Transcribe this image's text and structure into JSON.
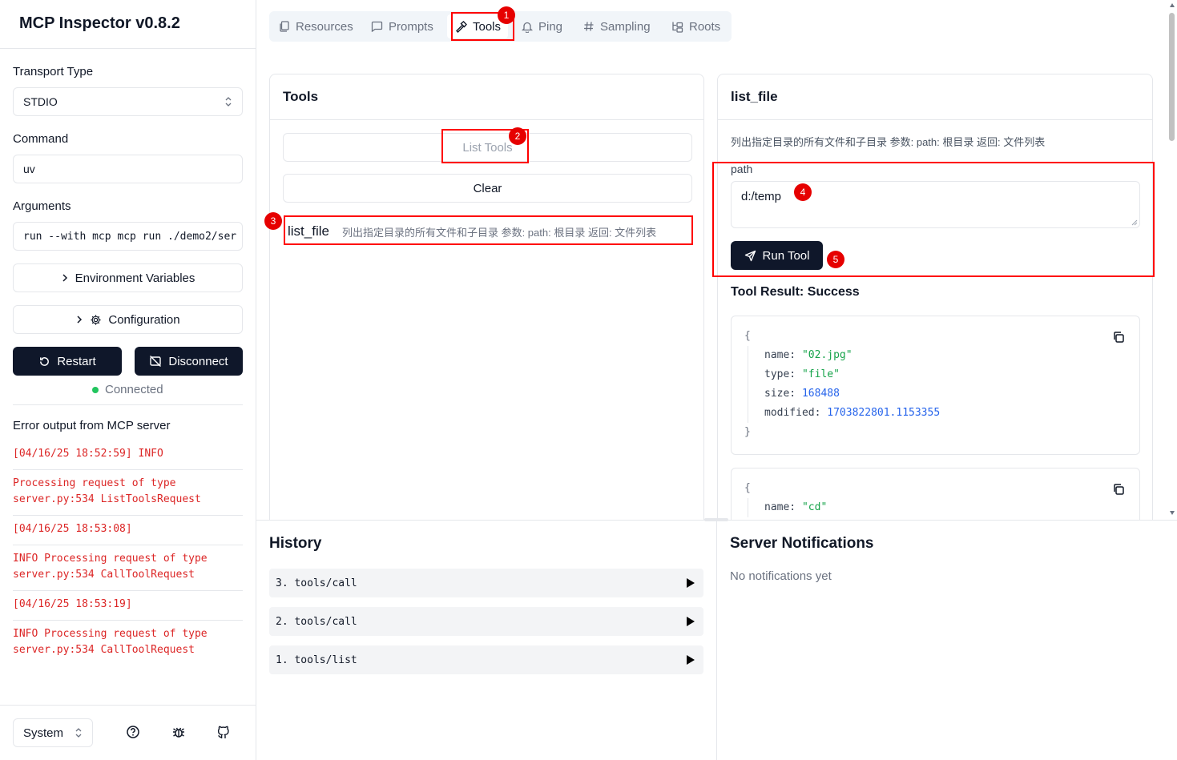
{
  "app": {
    "title": "MCP Inspector v0.8.2"
  },
  "sidebar": {
    "transport_label": "Transport Type",
    "transport_value": "STDIO",
    "command_label": "Command",
    "command_value": "uv",
    "arguments_label": "Arguments",
    "arguments_value": "run --with mcp mcp run ./demo2/ser",
    "env_button": "Environment Variables",
    "config_button": "Configuration",
    "restart_button": "Restart",
    "disconnect_button": "Disconnect",
    "status": "Connected",
    "status_color": "#22c55e",
    "error_title": "Error output from MCP server",
    "errors": [
      "[04/16/25 18:52:59] INFO",
      "Processing request of type server.py:534 ListToolsRequest",
      "[04/16/25 18:53:08]",
      "INFO Processing request of type server.py:534 CallToolRequest",
      "[04/16/25 18:53:19]",
      "INFO Processing request of type server.py:534 CallToolRequest"
    ],
    "theme_value": "System"
  },
  "tabs": [
    {
      "label": "Resources",
      "icon": "files-icon"
    },
    {
      "label": "Prompts",
      "icon": "message-icon"
    },
    {
      "label": "Tools",
      "icon": "hammer-icon",
      "active": true
    },
    {
      "label": "Ping",
      "icon": "bell-icon"
    },
    {
      "label": "Sampling",
      "icon": "hash-icon"
    },
    {
      "label": "Roots",
      "icon": "folder-tree-icon"
    }
  ],
  "tools_panel": {
    "title": "Tools",
    "list_button": "List Tools",
    "clear_button": "Clear",
    "tools": [
      {
        "name": "list_file",
        "description": "列出指定目录的所有文件和子目录 参数: path: 根目录 返回: 文件列表"
      }
    ]
  },
  "detail_panel": {
    "title": "list_file",
    "description": "列出指定目录的所有文件和子目录 参数: path: 根目录 返回: 文件列表",
    "param_label": "path",
    "param_value": "d:/temp",
    "run_button": "Run Tool",
    "result_title": "Tool Result: Success",
    "results": [
      {
        "name": "\"02.jpg\"",
        "type": "\"file\"",
        "size": "168488",
        "modified": "1703822801.1153355"
      },
      {
        "name": "\"cd\""
      }
    ],
    "keys": {
      "name": "name:",
      "type": "type:",
      "size": "size:",
      "modified": "modified:"
    },
    "brace_open": "{",
    "brace_close": "}"
  },
  "history": {
    "title": "History",
    "items": [
      "3. tools/call",
      "2. tools/call",
      "1. tools/list"
    ]
  },
  "notifications": {
    "title": "Server Notifications",
    "empty": "No notifications yet"
  },
  "annotations": [
    "1",
    "2",
    "3",
    "4",
    "5"
  ],
  "colors": {
    "accent_dark": "#0f172a",
    "annotation_red": "#ff0000",
    "error_red": "#dc2626"
  }
}
